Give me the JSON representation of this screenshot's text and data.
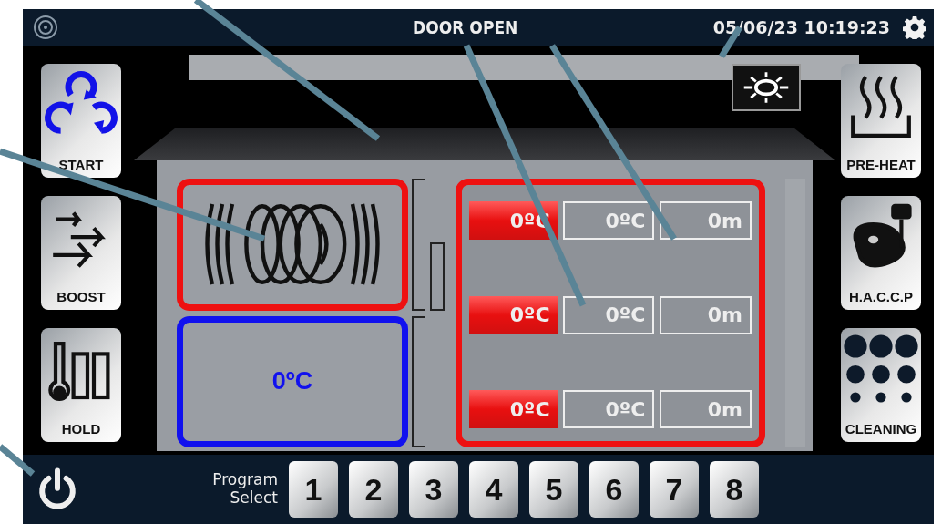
{
  "status_bar": {
    "door_status": "DOOR OPEN",
    "datetime": "05/06/23 10:19:23"
  },
  "left_buttons": [
    {
      "kind": "start",
      "label": "START"
    },
    {
      "kind": "boost",
      "label": "BOOST"
    },
    {
      "kind": "hold",
      "label": "HOLD"
    }
  ],
  "right_buttons": [
    {
      "kind": "preheat",
      "label": "PRE-HEAT"
    },
    {
      "kind": "haccp",
      "label": "H.A.C.C.P"
    },
    {
      "kind": "cleaning",
      "label": "CLEANING"
    }
  ],
  "left_compartments": [
    {
      "kind": "plate",
      "color": "#ee1111"
    },
    {
      "kind": "temperature",
      "temperature": "0ºC",
      "color": "#1111ee"
    }
  ],
  "right_compartment": {
    "color": "#ee1111",
    "zones": [
      {
        "set_temperature": "0ºC",
        "actual_temperature": "0ºC",
        "time": "0m"
      },
      {
        "set_temperature": "0ºC",
        "actual_temperature": "0ºC",
        "time": "0m"
      },
      {
        "set_temperature": "0ºC",
        "actual_temperature": "0ºC",
        "time": "0m"
      }
    ]
  },
  "program_select": {
    "label": "Program Select",
    "programs": [
      "1",
      "2",
      "3",
      "4",
      "5",
      "6",
      "7",
      "8"
    ]
  }
}
